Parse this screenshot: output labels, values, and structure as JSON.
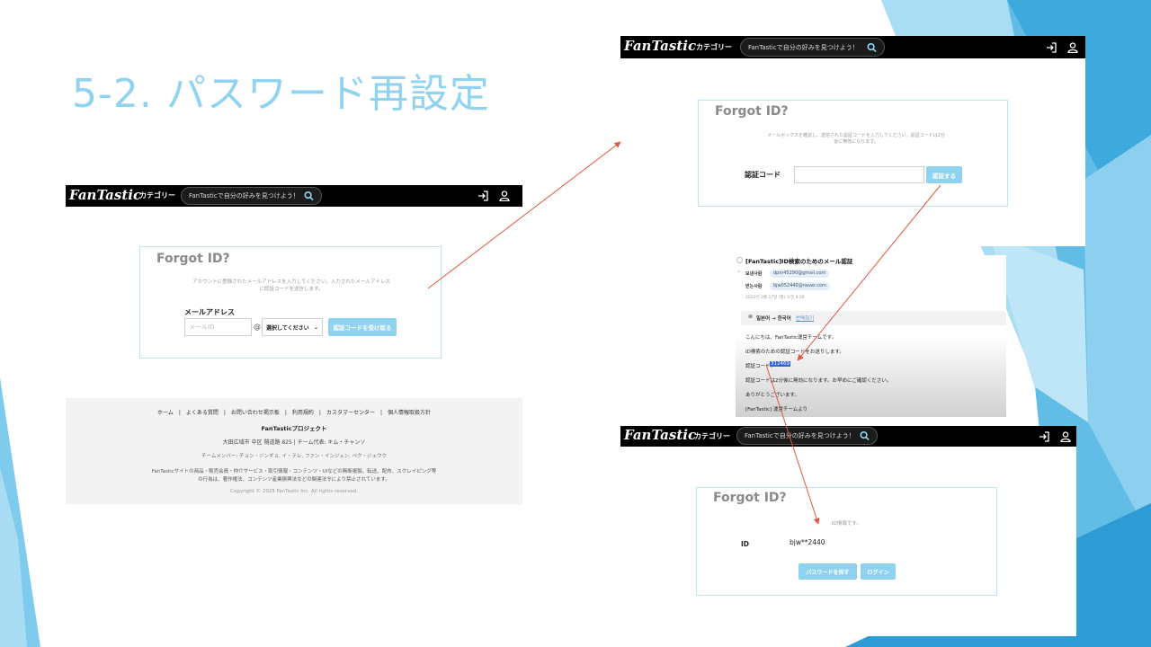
{
  "slide": {
    "title": "5-2. パスワード再設定"
  },
  "colors": {
    "accent": "#8fd3f0",
    "navbar": "#000000",
    "arrow": "#e2553d"
  },
  "navbar": {
    "logo": "FanTastic",
    "category": "カテゴリー",
    "search_placeholder": "FanTasticで自分の好みを見つけよう！",
    "search_icon": "search-icon",
    "login_icon": "login-icon",
    "user_icon": "user-icon"
  },
  "screen1": {
    "card_title": "Forgot ID?",
    "desc": [
      "アカウントに登録されたメールアドレスを入力してください。入力されたメールアドレス",
      "に認証コードを送信します。"
    ],
    "email_label": "メールアドレス",
    "email_placeholder": "メールID",
    "at": "@",
    "domain_select": "選択してください",
    "send_button": "認証コードを受け取る"
  },
  "footer": {
    "links": "ホーム　|　よくある質問　|　お問い合わせ掲示板　|　利用規約　|　カスタマーセンター　|　個人情報取扱方針",
    "project": "FanTasticプロジェクト",
    "address": "大田広域市 中区 隧道路 825 | チーム代表: キム・チャンソ",
    "members": "チームメンバー: チョン・ジンギョ, イ・テレ, ファン・インジュン, ペク・ジェウク",
    "notice1": "FanTasticサイトの商品・販売会員・仲介サービス・取引情報・コンテンツ・UIなどの無断複製、転送、配布、スクレイピング等",
    "notice2": "の行為は、著作権法、コンテンツ産業振興法などの関連法令により禁止されています。",
    "copyright": "Copyright © 2025 FanTastic Inc. All rights reserved."
  },
  "screen2": {
    "card_title": "Forgot ID?",
    "desc": [
      "メールボックスを確認し、送信された認証コードを入力してください。認証コードは2分",
      "後に無効になります。"
    ],
    "code_label": "認証コード",
    "confirm_button": "認証する"
  },
  "email": {
    "subject": "[FanTastic]ID検索のためのメール認証",
    "from_label": "보낸사람",
    "from": "dpm45290@gmail.com",
    "to_label": "받는사람",
    "to": "bjw052440@naver.com",
    "date": "2025년 3월 17일 (월) 오전 9:26",
    "translate": "일본어 → 한국어",
    "translate_link": "번역하기",
    "line1": "こんにちは、FanTastic運営チームです。",
    "line2": "ID検索のための認証コードをお送りします。",
    "code_prefix": "認証コード：",
    "code": "312469",
    "line4": "認証コードは2分後に無効になります。お早めにご確認ください。",
    "line5": "ありがとうございます。",
    "line6": "[FanTastic] 運営チームより"
  },
  "screen3": {
    "card_title": "Forgot ID?",
    "result_text": "ID情報です。",
    "id_label": "ID",
    "id_value": "bjw**2440",
    "reset_button": "パスワードを探す",
    "login_button": "ログイン"
  }
}
